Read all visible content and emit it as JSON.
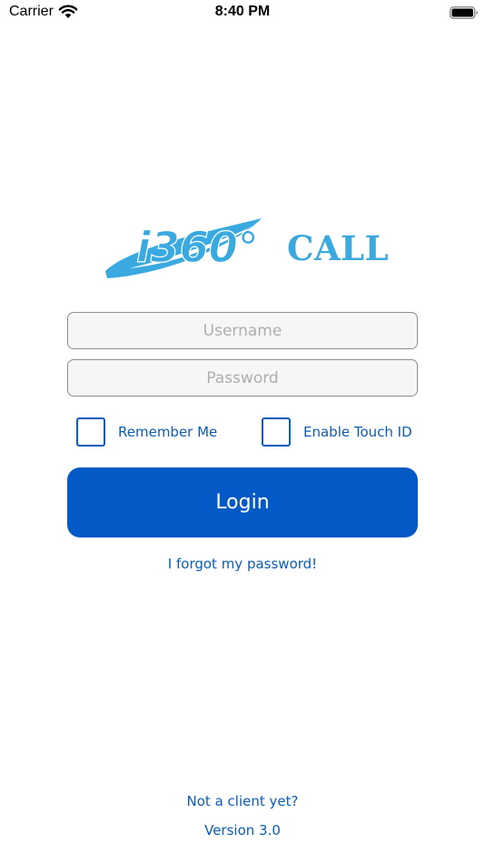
{
  "status_bar": {
    "carrier": "Carrier",
    "time": "8:40 PM",
    "icons": [
      "wifi-icon",
      "battery-icon"
    ]
  },
  "logo": {
    "mark_text": "i360°",
    "title": "CALL",
    "color": "#3aa9e0"
  },
  "form": {
    "username": {
      "value": "",
      "placeholder": "Username"
    },
    "password": {
      "value": "",
      "placeholder": "Password"
    },
    "remember_me": {
      "label": "Remember Me",
      "checked": false
    },
    "touch_id": {
      "label": "Enable Touch ID",
      "checked": false
    },
    "login_label": "Login",
    "forgot_label": "I forgot my password!"
  },
  "footer": {
    "not_client_label": "Not a client yet?",
    "version": "Version 3.0"
  },
  "colors": {
    "accent": "#0359c5",
    "link": "#0a5cb8",
    "logo": "#3aa9e0"
  }
}
